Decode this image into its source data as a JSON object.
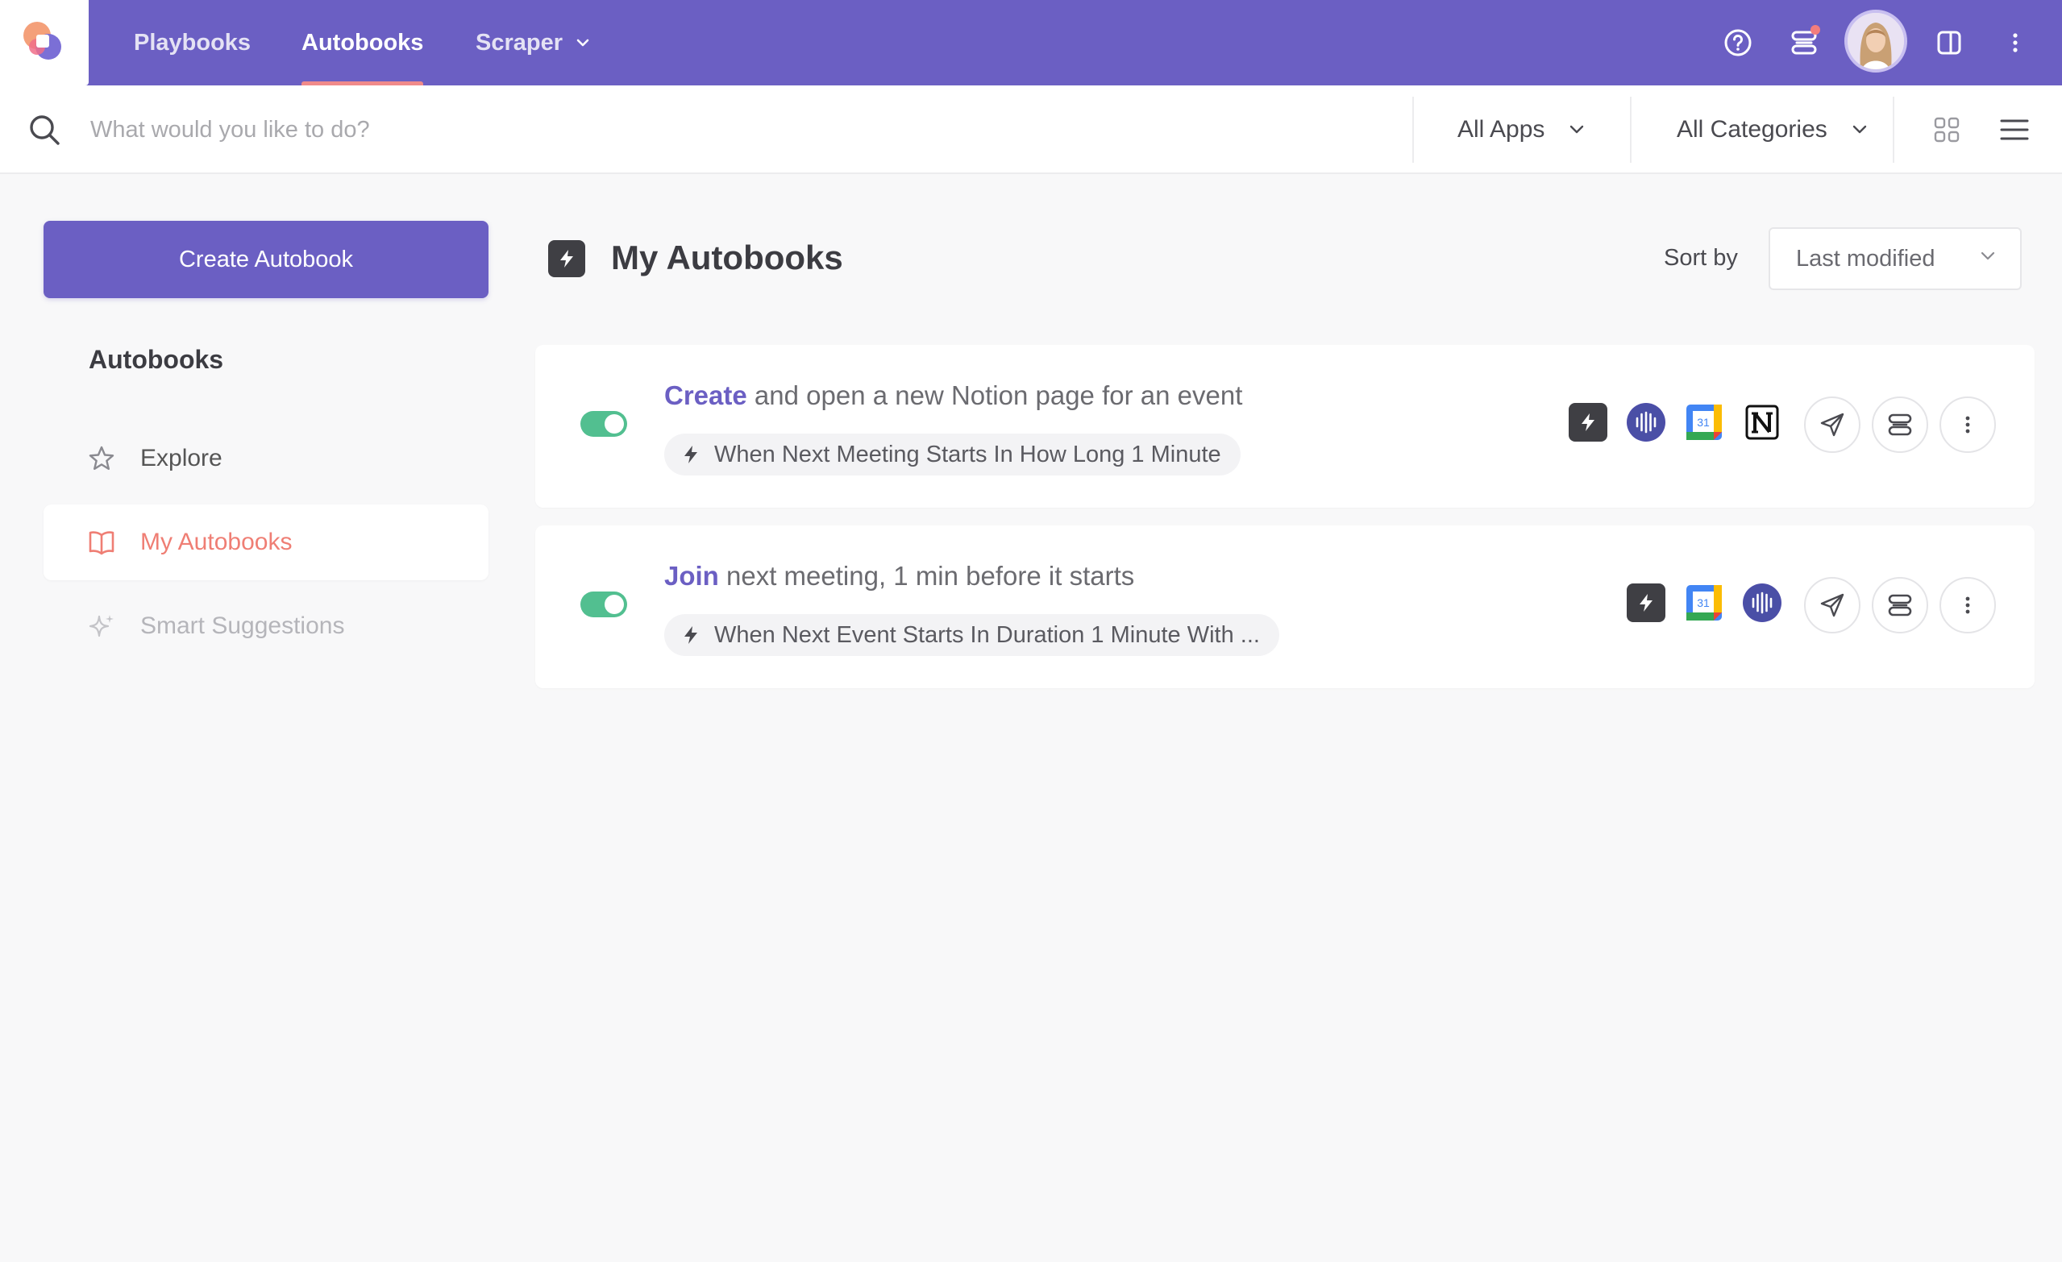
{
  "topnav": {
    "tabs": [
      {
        "label": "Playbooks"
      },
      {
        "label": "Autobooks"
      },
      {
        "label": "Scraper"
      }
    ],
    "active_tab": "Autobooks"
  },
  "search": {
    "placeholder": "What would you like to do?",
    "value": ""
  },
  "filters": {
    "apps_label": "All Apps",
    "categories_label": "All Categories"
  },
  "sidebar": {
    "create_button_label": "Create Autobook",
    "section_title": "Autobooks",
    "items": [
      {
        "label": "Explore",
        "icon": "star-icon"
      },
      {
        "label": "My Autobooks",
        "icon": "book-icon",
        "active": true
      },
      {
        "label": "Smart Suggestions",
        "icon": "sparkle-icon"
      }
    ]
  },
  "main": {
    "title": "My Autobooks",
    "sort_label": "Sort by",
    "sort_value": "Last modified",
    "autobooks": [
      {
        "enabled": true,
        "verb": "Create",
        "rest": " and open a new Notion page for an event",
        "trigger": "When Next Meeting Starts In How Long 1 Minute",
        "apps": [
          "autobook-bolt",
          "fireflies",
          "google-calendar",
          "notion"
        ]
      },
      {
        "enabled": true,
        "verb": "Join",
        "rest": " next meeting, 1 min before it starts",
        "trigger": "When Next Event Starts In Duration 1 Minute With ...",
        "apps": [
          "autobook-bolt",
          "google-calendar",
          "fireflies"
        ]
      }
    ]
  },
  "colors": {
    "brand": "#6b5fc3",
    "accent_active": "#ef7e74",
    "toggle_on": "#52bf90"
  },
  "calendar_day": "31"
}
